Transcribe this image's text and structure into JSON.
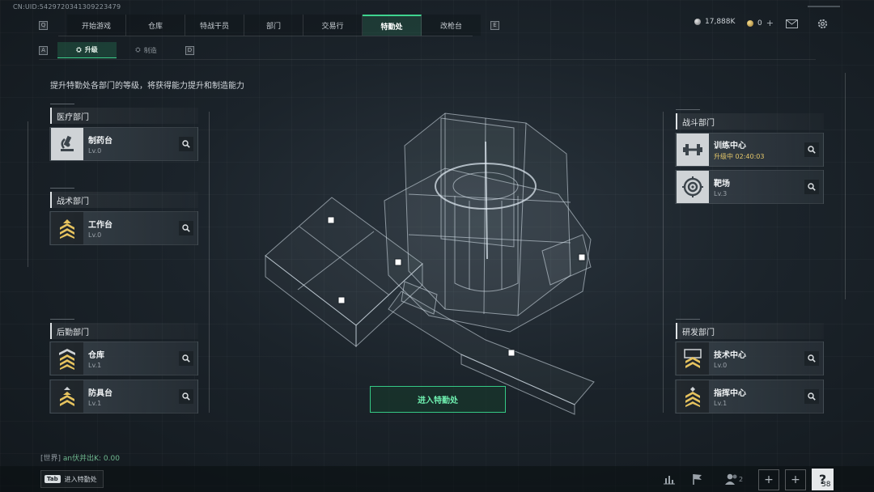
{
  "uid": "CN:UID:5429720341309223479",
  "nav": {
    "left_key": "Q",
    "right_key": "E",
    "tabs": [
      {
        "label": "开始游戏"
      },
      {
        "label": "仓库"
      },
      {
        "label": "特战干员"
      },
      {
        "label": "部门"
      },
      {
        "label": "交易行"
      },
      {
        "label": "特勤处",
        "active": true
      },
      {
        "label": "改枪台"
      }
    ]
  },
  "currency": {
    "silver": "17,888K",
    "gold": "0"
  },
  "subnav": {
    "left_key": "A",
    "right_key": "D",
    "tabs": [
      {
        "label": "升级",
        "active": true
      },
      {
        "label": "制造"
      }
    ]
  },
  "description": "提升特勤处各部门的等级，将获得能力提升和制造能力",
  "departments": {
    "medical": {
      "title": "医疗部门",
      "items": [
        {
          "name": "制药台",
          "level": "Lv.0",
          "icon": "microscope-icon"
        }
      ]
    },
    "tactical": {
      "title": "战术部门",
      "items": [
        {
          "name": "工作台",
          "level": "Lv.0",
          "icon": "rank-chevron-icon"
        }
      ]
    },
    "logistics": {
      "title": "后勤部门",
      "items": [
        {
          "name": "仓库",
          "level": "Lv.1",
          "icon": "rank-chevron-icon"
        },
        {
          "name": "防具台",
          "level": "Lv.1",
          "icon": "rank-chevron-icon"
        }
      ]
    },
    "combat": {
      "title": "战斗部门",
      "items": [
        {
          "name": "训练中心",
          "level": "升级中 02:40:03",
          "icon": "dumbbell-icon",
          "upgrading": true
        },
        {
          "name": "靶场",
          "level": "Lv.3",
          "icon": "target-icon"
        }
      ]
    },
    "research": {
      "title": "研发部门",
      "items": [
        {
          "name": "技术中心",
          "level": "Lv.0",
          "icon": "rank-chevron-icon"
        },
        {
          "name": "指挥中心",
          "level": "Lv.1",
          "icon": "rank-chevron-icon"
        }
      ]
    }
  },
  "enter_button": "进入特勤处",
  "chat": {
    "channel": "[世界]",
    "message": "an伏并出K: 0.00"
  },
  "bottom": {
    "tab_key": "Tab",
    "tab_label": "进入特勤处",
    "friend_count": "2",
    "help_count": "38"
  },
  "colors": {
    "accent": "#3fd48f",
    "upgrading": "#e4c76a",
    "background": "#1b232a"
  }
}
